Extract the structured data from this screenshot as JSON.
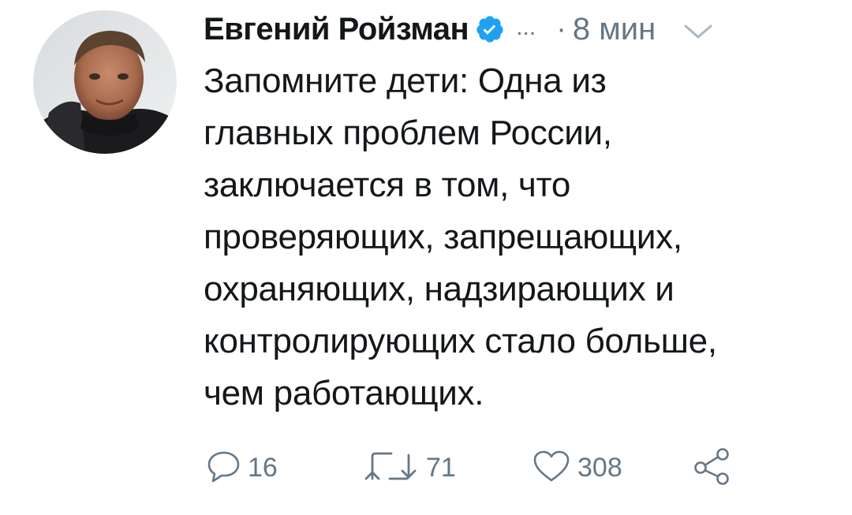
{
  "tweet": {
    "author_name": "Евгений Ройзман",
    "more_label": "...",
    "separator": "·",
    "timestamp": "8 мин",
    "text": "Запомните дети: Одна из\nглавных проблем России,\nзаключается в том, что\nпроверяющих, запрещающих,\nохраняющих, надзирающих и\nконтролирующих стало больше,\nчем работающих.",
    "reply_count": "16",
    "retweet_count": "71",
    "like_count": "308"
  },
  "icons": {
    "verified": "verified-badge-icon",
    "chevron": "chevron-down-icon",
    "reply": "reply-icon",
    "retweet": "retweet-icon",
    "like": "heart-icon",
    "share": "share-icon"
  },
  "colors": {
    "text": "#14171a",
    "secondary": "#657786",
    "verified": "#1da1f2",
    "background": "#ffffff"
  }
}
